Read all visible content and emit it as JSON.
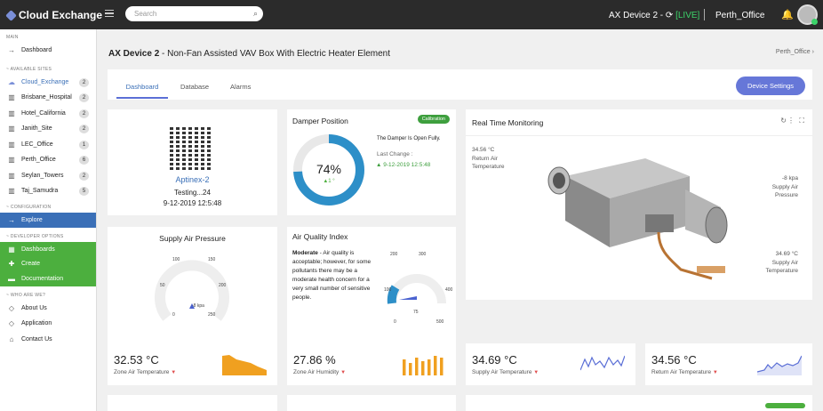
{
  "app": {
    "title": "Cloud Exchange",
    "search_placeholder": "Search"
  },
  "topbar": {
    "device": "AX Device 2 -",
    "live": "[LIVE]",
    "site": "Perth_Office"
  },
  "sidebar": {
    "main_header": "MAIN",
    "dashboard": "Dashboard",
    "sites_header": "~ AVAILABLE SITES",
    "sites": [
      {
        "label": "Cloud_Exchange",
        "count": "2"
      },
      {
        "label": "Brisbane_Hospital",
        "count": "2"
      },
      {
        "label": "Hotel_California",
        "count": "2"
      },
      {
        "label": "Janith_Site",
        "count": "2"
      },
      {
        "label": "LEC_Office",
        "count": "1"
      },
      {
        "label": "Perth_Office",
        "count": "6"
      },
      {
        "label": "Seylan_Towers",
        "count": "2"
      },
      {
        "label": "Taj_Samudra",
        "count": "5"
      }
    ],
    "config_header": "~ CONFIGURATION",
    "explore": "Explore",
    "dev_header": "~ DEVELOPER OPTIONS",
    "dev_items": [
      "Dashboards",
      "Create",
      "Documentation"
    ],
    "who_header": "~ WHO ARE WE?",
    "who_items": [
      "About Us",
      "Application",
      "Contact Us"
    ]
  },
  "page": {
    "title_bold": "AX Device 2",
    "title_rest": " - Non-Fan Assisted VAV Box With Electric Heater Element",
    "breadcrumb": "Perth_Office"
  },
  "tabs": [
    "Dashboard",
    "Database",
    "Alarms"
  ],
  "settings_button": "Device Settings",
  "device_card": {
    "name": "Aptinex-2",
    "status": "Testing...24",
    "date": "9-12-2019 12:5:48"
  },
  "damper": {
    "title": "Damper Position",
    "badge": "Calibration",
    "percent": 74,
    "value_text": "74%",
    "delta": "▲1 °",
    "message": "The Damper Is Open Fully.",
    "last_change_label": "Last Change :",
    "last_change": "▲ 9-12-2019 12:5:48"
  },
  "pressure": {
    "title": "Supply Air Pressure",
    "unit": "-8 kpa",
    "ticks": [
      "0",
      "50",
      "100",
      "150",
      "200",
      "250"
    ],
    "value": -8,
    "range": [
      0,
      250
    ]
  },
  "aqi": {
    "title": "Air Quality Index",
    "level": "Moderate",
    "text": " - Air quality is acceptable; however, for some pollutants there may be a moderate health concern for a very small number of sensitive people.",
    "ticks": [
      "0",
      "100",
      "200",
      "300",
      "400",
      "500"
    ],
    "extra_tick": "75",
    "value": 75
  },
  "rtm": {
    "title": "Real Time Monitoring",
    "left_value": "34.56 °C",
    "left_label": "Return Air Temperature",
    "right1_value": "-8 kpa",
    "right1_label": "Supply Air Pressure",
    "right2_value": "34.69 °C",
    "right2_label": "Supply Air Temperature"
  },
  "stats": [
    {
      "value": "32.53 °C",
      "label": "Zone Air Temperature",
      "color": "#f0a020",
      "kind": "area"
    },
    {
      "value": "27.86 %",
      "label": "Zone Air Humidity",
      "color": "#f0a020",
      "kind": "bars"
    },
    {
      "value": "34.69 °C",
      "label": "Supply Air Temperature",
      "color": "#5b6fd6",
      "kind": "line"
    },
    {
      "value": "34.56 °C",
      "label": "Return Air Temperature",
      "color": "#5b6fd6",
      "kind": "line2"
    }
  ]
}
